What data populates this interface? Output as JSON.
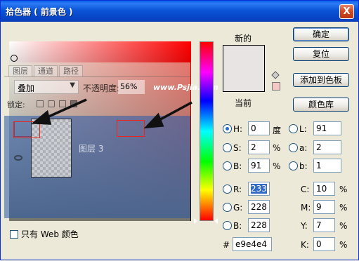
{
  "window": {
    "title": "拾色器 ( 前景色 )",
    "close_label": "X"
  },
  "swatch": {
    "new_label": "新的",
    "current_label": "当前",
    "new_color": "#e9e4e4",
    "current_color": "#e9e4e4"
  },
  "buttons": {
    "ok": "确定",
    "reset": "复位",
    "add_swatch": "添加到色板",
    "libraries": "颜色库"
  },
  "hsb": {
    "h": {
      "label": "H:",
      "value": "0",
      "unit": "度"
    },
    "s": {
      "label": "S:",
      "value": "2",
      "unit": "%"
    },
    "b": {
      "label": "B:",
      "value": "91",
      "unit": "%"
    }
  },
  "rgb": {
    "r": {
      "label": "R:",
      "value": "233"
    },
    "g": {
      "label": "G:",
      "value": "228"
    },
    "b": {
      "label": "B:",
      "value": "228"
    }
  },
  "lab": {
    "l": {
      "label": "L:",
      "value": "91"
    },
    "a": {
      "label": "a:",
      "value": "2"
    },
    "b": {
      "label": "b:",
      "value": "1"
    }
  },
  "cmyk": {
    "c": {
      "label": "C:",
      "value": "10",
      "unit": "%"
    },
    "m": {
      "label": "M:",
      "value": "9",
      "unit": "%"
    },
    "y": {
      "label": "Y:",
      "value": "7",
      "unit": "%"
    },
    "k": {
      "label": "K:",
      "value": "0",
      "unit": "%"
    }
  },
  "hex": {
    "label": "#",
    "value": "e9e4e4"
  },
  "web_only": {
    "label": "只有 Web 颜色"
  },
  "layers_panel": {
    "tabs": [
      "图层",
      "通道",
      "路径"
    ],
    "blend_mode": "叠加",
    "opacity_label": "不透明度:",
    "opacity_value": "56%",
    "watermark": "www.Psjia.com",
    "lock_label": "锁定:",
    "layer_name": "图层 3"
  }
}
